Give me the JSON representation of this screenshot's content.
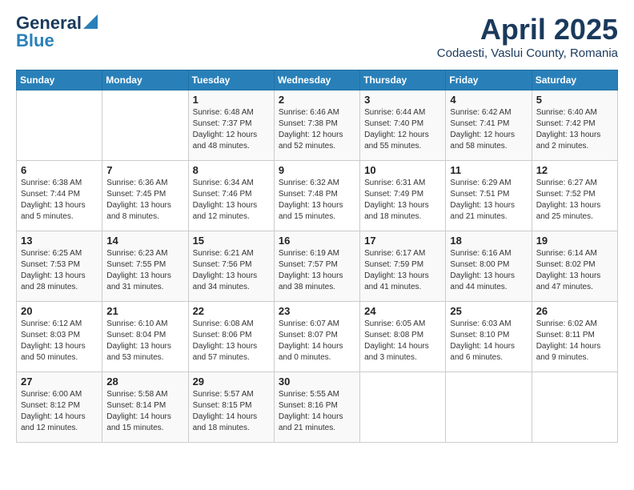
{
  "logo": {
    "line1": "General",
    "line2": "Blue"
  },
  "title": "April 2025",
  "subtitle": "Codaesti, Vaslui County, Romania",
  "weekdays": [
    "Sunday",
    "Monday",
    "Tuesday",
    "Wednesday",
    "Thursday",
    "Friday",
    "Saturday"
  ],
  "weeks": [
    [
      {
        "day": "",
        "info": ""
      },
      {
        "day": "",
        "info": ""
      },
      {
        "day": "1",
        "info": "Sunrise: 6:48 AM\nSunset: 7:37 PM\nDaylight: 12 hours\nand 48 minutes."
      },
      {
        "day": "2",
        "info": "Sunrise: 6:46 AM\nSunset: 7:38 PM\nDaylight: 12 hours\nand 52 minutes."
      },
      {
        "day": "3",
        "info": "Sunrise: 6:44 AM\nSunset: 7:40 PM\nDaylight: 12 hours\nand 55 minutes."
      },
      {
        "day": "4",
        "info": "Sunrise: 6:42 AM\nSunset: 7:41 PM\nDaylight: 12 hours\nand 58 minutes."
      },
      {
        "day": "5",
        "info": "Sunrise: 6:40 AM\nSunset: 7:42 PM\nDaylight: 13 hours\nand 2 minutes."
      }
    ],
    [
      {
        "day": "6",
        "info": "Sunrise: 6:38 AM\nSunset: 7:44 PM\nDaylight: 13 hours\nand 5 minutes."
      },
      {
        "day": "7",
        "info": "Sunrise: 6:36 AM\nSunset: 7:45 PM\nDaylight: 13 hours\nand 8 minutes."
      },
      {
        "day": "8",
        "info": "Sunrise: 6:34 AM\nSunset: 7:46 PM\nDaylight: 13 hours\nand 12 minutes."
      },
      {
        "day": "9",
        "info": "Sunrise: 6:32 AM\nSunset: 7:48 PM\nDaylight: 13 hours\nand 15 minutes."
      },
      {
        "day": "10",
        "info": "Sunrise: 6:31 AM\nSunset: 7:49 PM\nDaylight: 13 hours\nand 18 minutes."
      },
      {
        "day": "11",
        "info": "Sunrise: 6:29 AM\nSunset: 7:51 PM\nDaylight: 13 hours\nand 21 minutes."
      },
      {
        "day": "12",
        "info": "Sunrise: 6:27 AM\nSunset: 7:52 PM\nDaylight: 13 hours\nand 25 minutes."
      }
    ],
    [
      {
        "day": "13",
        "info": "Sunrise: 6:25 AM\nSunset: 7:53 PM\nDaylight: 13 hours\nand 28 minutes."
      },
      {
        "day": "14",
        "info": "Sunrise: 6:23 AM\nSunset: 7:55 PM\nDaylight: 13 hours\nand 31 minutes."
      },
      {
        "day": "15",
        "info": "Sunrise: 6:21 AM\nSunset: 7:56 PM\nDaylight: 13 hours\nand 34 minutes."
      },
      {
        "day": "16",
        "info": "Sunrise: 6:19 AM\nSunset: 7:57 PM\nDaylight: 13 hours\nand 38 minutes."
      },
      {
        "day": "17",
        "info": "Sunrise: 6:17 AM\nSunset: 7:59 PM\nDaylight: 13 hours\nand 41 minutes."
      },
      {
        "day": "18",
        "info": "Sunrise: 6:16 AM\nSunset: 8:00 PM\nDaylight: 13 hours\nand 44 minutes."
      },
      {
        "day": "19",
        "info": "Sunrise: 6:14 AM\nSunset: 8:02 PM\nDaylight: 13 hours\nand 47 minutes."
      }
    ],
    [
      {
        "day": "20",
        "info": "Sunrise: 6:12 AM\nSunset: 8:03 PM\nDaylight: 13 hours\nand 50 minutes."
      },
      {
        "day": "21",
        "info": "Sunrise: 6:10 AM\nSunset: 8:04 PM\nDaylight: 13 hours\nand 53 minutes."
      },
      {
        "day": "22",
        "info": "Sunrise: 6:08 AM\nSunset: 8:06 PM\nDaylight: 13 hours\nand 57 minutes."
      },
      {
        "day": "23",
        "info": "Sunrise: 6:07 AM\nSunset: 8:07 PM\nDaylight: 14 hours\nand 0 minutes."
      },
      {
        "day": "24",
        "info": "Sunrise: 6:05 AM\nSunset: 8:08 PM\nDaylight: 14 hours\nand 3 minutes."
      },
      {
        "day": "25",
        "info": "Sunrise: 6:03 AM\nSunset: 8:10 PM\nDaylight: 14 hours\nand 6 minutes."
      },
      {
        "day": "26",
        "info": "Sunrise: 6:02 AM\nSunset: 8:11 PM\nDaylight: 14 hours\nand 9 minutes."
      }
    ],
    [
      {
        "day": "27",
        "info": "Sunrise: 6:00 AM\nSunset: 8:12 PM\nDaylight: 14 hours\nand 12 minutes."
      },
      {
        "day": "28",
        "info": "Sunrise: 5:58 AM\nSunset: 8:14 PM\nDaylight: 14 hours\nand 15 minutes."
      },
      {
        "day": "29",
        "info": "Sunrise: 5:57 AM\nSunset: 8:15 PM\nDaylight: 14 hours\nand 18 minutes."
      },
      {
        "day": "30",
        "info": "Sunrise: 5:55 AM\nSunset: 8:16 PM\nDaylight: 14 hours\nand 21 minutes."
      },
      {
        "day": "",
        "info": ""
      },
      {
        "day": "",
        "info": ""
      },
      {
        "day": "",
        "info": ""
      }
    ]
  ]
}
